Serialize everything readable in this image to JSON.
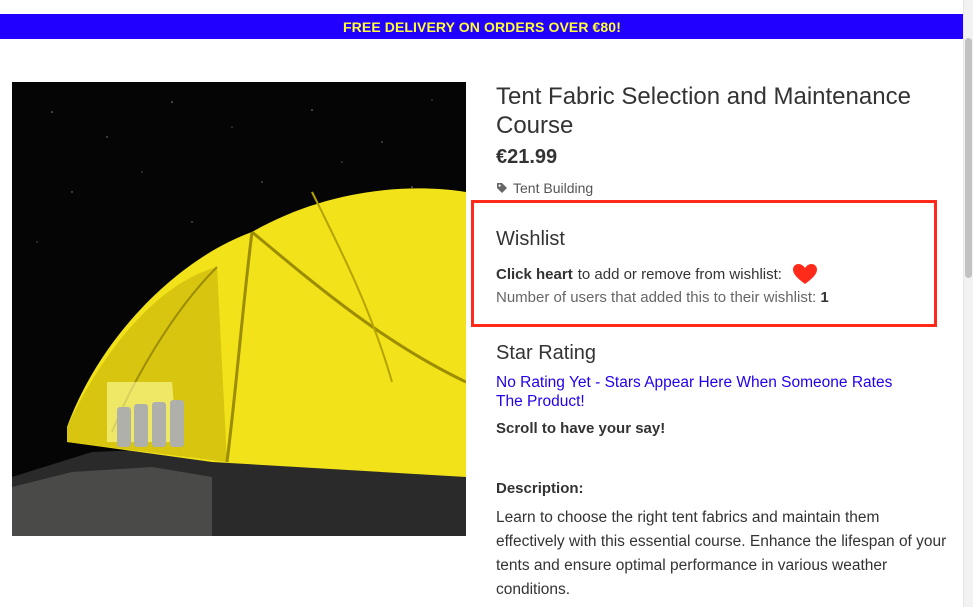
{
  "banner": {
    "text": "FREE DELIVERY ON ORDERS OVER €80!"
  },
  "product": {
    "title": "Tent Fabric Selection and Maintenance Course",
    "price": "€21.99",
    "category": "Tent Building",
    "image_alt": "Yellow tent at night with boots outside"
  },
  "wishlist": {
    "heading": "Wishlist",
    "instruction_bold": "Click heart",
    "instruction_rest": "to add or remove from wishlist:",
    "count_label": "Number of users that added this to their wishlist:",
    "count_value": "1"
  },
  "rating": {
    "heading": "Star Rating",
    "link_text": "No Rating Yet - Stars Appear Here When Someone Rates The Product!",
    "cta": "Scroll to have your say!"
  },
  "description": {
    "label": "Description:",
    "text": "Learn to choose the right tent fabrics and maintain them effectively with this essential course. Enhance the lifespan of your tents and ensure optimal performance in various weather conditions."
  },
  "colors": {
    "banner_bg": "#2200ff",
    "banner_text": "#ffff33",
    "highlight_border": "#ff2a1a",
    "heart": "#ff2a1a",
    "link": "#2200ee"
  }
}
